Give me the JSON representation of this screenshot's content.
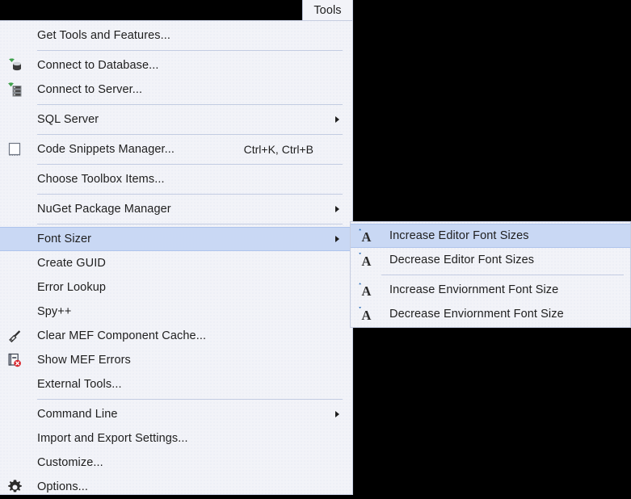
{
  "tab": {
    "label": "Tools"
  },
  "colors": {
    "menu_background": "#F2F3F8",
    "menu_border": "#C6CDE0",
    "highlight": "#C9D8F4",
    "highlight_border": "#AFC4EC",
    "separator": "#C3CCE2",
    "text": "#1E1E1E",
    "accent_blue": "#1B65B3",
    "accent_green": "#3FA14B",
    "error_red": "#D8232A"
  },
  "menu": {
    "name": "Tools",
    "items": [
      {
        "label": "Get Tools and Features...",
        "icon": "",
        "shortcut": "",
        "submenu": false,
        "highlighted": false,
        "separator_after": true
      },
      {
        "label": "Connect to Database...",
        "icon": "database-icon",
        "shortcut": "",
        "submenu": false,
        "highlighted": false,
        "separator_after": false
      },
      {
        "label": "Connect to Server...",
        "icon": "server-icon",
        "shortcut": "",
        "submenu": false,
        "highlighted": false,
        "separator_after": true
      },
      {
        "label": "SQL Server",
        "icon": "",
        "shortcut": "",
        "submenu": true,
        "highlighted": false,
        "separator_after": true
      },
      {
        "label": "Code Snippets Manager...",
        "icon": "code-snippets-icon",
        "shortcut": "Ctrl+K, Ctrl+B",
        "submenu": false,
        "highlighted": false,
        "separator_after": true
      },
      {
        "label": "Choose Toolbox Items...",
        "icon": "",
        "shortcut": "",
        "submenu": false,
        "highlighted": false,
        "separator_after": true
      },
      {
        "label": "NuGet Package Manager",
        "icon": "",
        "shortcut": "",
        "submenu": true,
        "highlighted": false,
        "separator_after": true
      },
      {
        "label": "Font Sizer",
        "icon": "",
        "shortcut": "",
        "submenu": true,
        "highlighted": true,
        "separator_after": false
      },
      {
        "label": "Create GUID",
        "icon": "",
        "shortcut": "",
        "submenu": false,
        "highlighted": false,
        "separator_after": false
      },
      {
        "label": "Error Lookup",
        "icon": "",
        "shortcut": "",
        "submenu": false,
        "highlighted": false,
        "separator_after": false
      },
      {
        "label": "Spy++",
        "icon": "",
        "shortcut": "",
        "submenu": false,
        "highlighted": false,
        "separator_after": false
      },
      {
        "label": "Clear MEF Component Cache...",
        "icon": "broom-icon",
        "shortcut": "",
        "submenu": false,
        "highlighted": false,
        "separator_after": false
      },
      {
        "label": "Show MEF Errors",
        "icon": "document-error-icon",
        "shortcut": "",
        "submenu": false,
        "highlighted": false,
        "separator_after": false
      },
      {
        "label": "External Tools...",
        "icon": "",
        "shortcut": "",
        "submenu": false,
        "highlighted": false,
        "separator_after": true
      },
      {
        "label": "Command Line",
        "icon": "",
        "shortcut": "",
        "submenu": true,
        "highlighted": false,
        "separator_after": false
      },
      {
        "label": "Import and Export Settings...",
        "icon": "",
        "shortcut": "",
        "submenu": false,
        "highlighted": false,
        "separator_after": false
      },
      {
        "label": "Customize...",
        "icon": "",
        "shortcut": "",
        "submenu": false,
        "highlighted": false,
        "separator_after": false
      },
      {
        "label": "Options...",
        "icon": "gear-icon",
        "shortcut": "",
        "submenu": false,
        "highlighted": false,
        "separator_after": false
      }
    ]
  },
  "submenu": {
    "parent": "Font Sizer",
    "items": [
      {
        "label": "Increase Editor Font Sizes",
        "icon": "font-increase-icon",
        "highlighted": true,
        "separator_after": false
      },
      {
        "label": "Decrease Editor Font Sizes",
        "icon": "font-decrease-icon",
        "highlighted": false,
        "separator_after": true
      },
      {
        "label": "Increase Enviornment Font Size",
        "icon": "font-increase-icon",
        "highlighted": false,
        "separator_after": false
      },
      {
        "label": "Decrease Enviornment Font Size",
        "icon": "font-decrease-icon",
        "highlighted": false,
        "separator_after": false
      }
    ]
  }
}
